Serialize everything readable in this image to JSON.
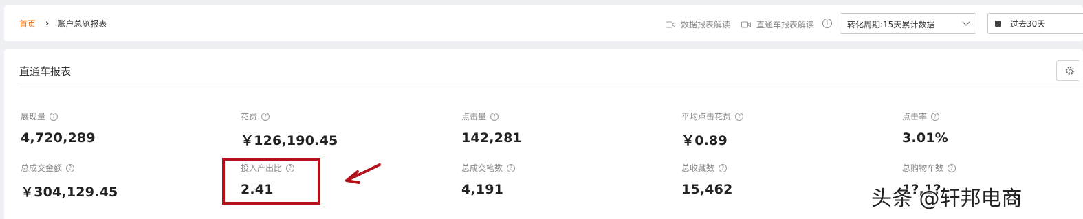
{
  "breadcrumb": {
    "home": "首页",
    "current": "账户总览报表"
  },
  "header": {
    "help_links": [
      "数据报表解读",
      "直通车报表解读"
    ],
    "conversion_period": "转化周期:15天累计数据",
    "date_range": "过去30天"
  },
  "panel": {
    "title": "直通车报表"
  },
  "metrics": [
    {
      "label": "展现量",
      "value": "4,720,289"
    },
    {
      "label": "花费",
      "value": "￥126,190.45"
    },
    {
      "label": "点击量",
      "value": "142,281"
    },
    {
      "label": "平均点击花费",
      "value": "￥0.89"
    },
    {
      "label": "点击率",
      "value": "3.01%"
    },
    {
      "label": "总成交金额",
      "value": "￥304,129.45"
    },
    {
      "label": "投入产出比",
      "value": "2.41"
    },
    {
      "label": "总成交笔数",
      "value": "4,191"
    },
    {
      "label": "总收藏数",
      "value": "15,462"
    },
    {
      "label": "总购物车数",
      "value": "1?,1?"
    }
  ],
  "annotation": {
    "box_color": "#b3121a",
    "arrow_color": "#b3121a"
  },
  "watermark": "头条 @轩邦电商",
  "colors": {
    "accent": "#ff6a00",
    "text": "#333333",
    "muted": "#888888"
  }
}
